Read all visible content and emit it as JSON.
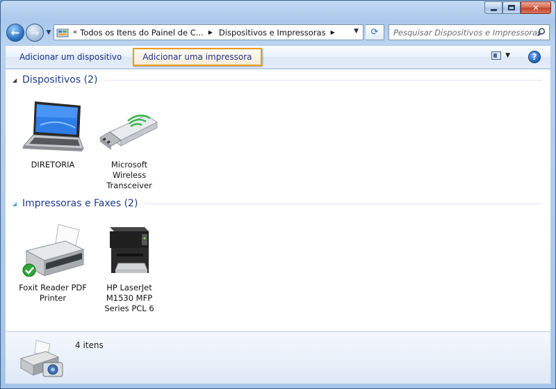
{
  "window": {
    "caption_buttons": [
      "minimize",
      "maximize",
      "close"
    ]
  },
  "address_bar": {
    "overflow_chevron": "«",
    "crumbs": [
      "Todos os Itens do Painel de C...",
      "Dispositivos e Impressoras"
    ]
  },
  "search": {
    "placeholder": "Pesquisar Dispositivos e Impressoras"
  },
  "command_bar": {
    "add_device": "Adicionar um dispositivo",
    "add_printer": "Adicionar uma impressora"
  },
  "groups": [
    {
      "title": "Dispositivos (2)",
      "items": [
        {
          "label_lines": [
            "DIRETORIA"
          ],
          "icon": "laptop-icon"
        },
        {
          "label_lines": [
            "Microsoft",
            "Wireless",
            "Transceiver"
          ],
          "icon": "usb-transceiver-icon"
        }
      ]
    },
    {
      "title": "Impressoras e Faxes (2)",
      "items": [
        {
          "label_lines": [
            "Foxit Reader PDF",
            "Printer"
          ],
          "icon": "printer-icon",
          "default": true
        },
        {
          "label_lines": [
            "HP LaserJet",
            "M1530 MFP",
            "Series PCL 6"
          ],
          "icon": "mfp-printer-icon"
        }
      ]
    }
  ],
  "details": {
    "count": "4 itens",
    "icon": "devices-and-printers-icon"
  },
  "colors": {
    "highlight_border": "#e89c17",
    "link_text": "#1e3287",
    "group_title": "#1e3a8a"
  }
}
